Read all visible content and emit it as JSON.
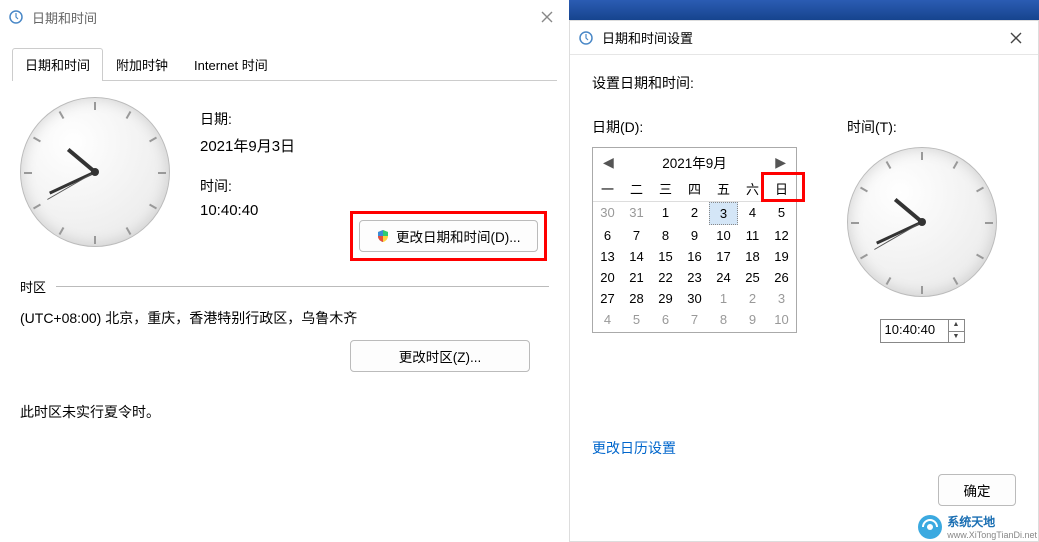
{
  "win_left": {
    "title": "日期和时间",
    "tabs": [
      "日期和时间",
      "附加时钟",
      "Internet 时间"
    ],
    "active_tab": 0,
    "date_label": "日期:",
    "date_value": "2021年9月3日",
    "time_label": "时间:",
    "time_value": "10:40:40",
    "change_dt_label": "更改日期和时间(D)...",
    "tz_section": "时区",
    "tz_value": "(UTC+08:00) 北京，重庆，香港特别行政区，乌鲁木齐",
    "change_tz_label": "更改时区(Z)...",
    "dst_note": "此时区未实行夏令时。"
  },
  "win_right": {
    "title": "日期和时间设置",
    "instruction": "设置日期和时间:",
    "date_col_label": "日期(D):",
    "time_col_label": "时间(T):",
    "calendar": {
      "month_label": "2021年9月",
      "weekdays": [
        "一",
        "二",
        "三",
        "四",
        "五",
        "六",
        "日"
      ],
      "days": [
        {
          "n": 30,
          "o": true
        },
        {
          "n": 31,
          "o": true
        },
        {
          "n": 1
        },
        {
          "n": 2
        },
        {
          "n": 3,
          "sel": true
        },
        {
          "n": 4
        },
        {
          "n": 5
        },
        {
          "n": 6
        },
        {
          "n": 7
        },
        {
          "n": 8
        },
        {
          "n": 9
        },
        {
          "n": 10
        },
        {
          "n": 11
        },
        {
          "n": 12
        },
        {
          "n": 13
        },
        {
          "n": 14
        },
        {
          "n": 15
        },
        {
          "n": 16
        },
        {
          "n": 17
        },
        {
          "n": 18
        },
        {
          "n": 19
        },
        {
          "n": 20
        },
        {
          "n": 21
        },
        {
          "n": 22
        },
        {
          "n": 23
        },
        {
          "n": 24
        },
        {
          "n": 25
        },
        {
          "n": 26
        },
        {
          "n": 27
        },
        {
          "n": 28
        },
        {
          "n": 29
        },
        {
          "n": 30
        },
        {
          "n": 1,
          "o": true
        },
        {
          "n": 2,
          "o": true
        },
        {
          "n": 3,
          "o": true
        },
        {
          "n": 4,
          "o": true
        },
        {
          "n": 5,
          "o": true
        },
        {
          "n": 6,
          "o": true
        },
        {
          "n": 7,
          "o": true
        },
        {
          "n": 8,
          "o": true
        },
        {
          "n": 9,
          "o": true
        },
        {
          "n": 10,
          "o": true
        }
      ]
    },
    "time_value": "10:40:40",
    "change_cal_link": "更改日历设置",
    "ok_label": "确定"
  },
  "watermark": {
    "line1": "系统天地",
    "line2": "www.XiTongTianDi.net"
  }
}
